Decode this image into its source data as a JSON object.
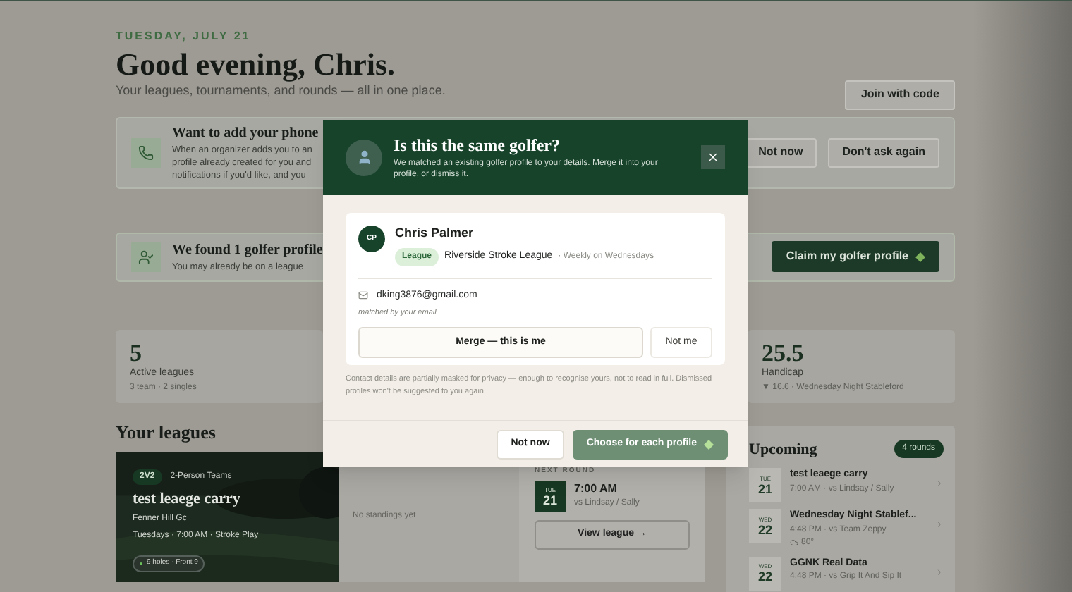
{
  "header": {
    "date": "TUESDAY, JULY 21",
    "title": "Good evening, Chris.",
    "subtitle": "Your leagues, tournaments, and rounds — all in one place.",
    "join_button": "Join with code"
  },
  "phone_banner": {
    "title": "Want to add your phone",
    "lines": [
      "When an organizer adds you to an",
      "profile already created for you and",
      "notifications if you'd like, and you"
    ],
    "buttons": [
      "Not now",
      "Don't ask again"
    ]
  },
  "profile_banner": {
    "title": "We found 1 golfer profile",
    "text": "You may already be on a league",
    "button": "Claim my golfer profile"
  },
  "stats": [
    {
      "value": "5",
      "label": "Active leagues",
      "detail": "3 team · 2 singles"
    },
    {
      "value": "25.5",
      "label": "Handicap",
      "detail": "▼ 16.6 · Wednesday Night Stableford"
    }
  ],
  "leagues": {
    "heading": "Your leagues",
    "card": {
      "format_badge": "2V2",
      "format": "2-Person Teams",
      "name": "test leaege carry",
      "course": "Fenner Hill Gc",
      "schedule": "Tuesdays · 7:00 AM · Stroke Play",
      "holes": "9 holes · Front 9",
      "standings": "No standings yet",
      "next_round": {
        "label": "NEXT ROUND",
        "day": "TUE",
        "date": "21",
        "time": "7:00 AM",
        "opponents": "vs Lindsay / Sally",
        "button": "View league →"
      }
    }
  },
  "upcoming": {
    "heading": "Upcoming",
    "count": "4 rounds",
    "items": [
      {
        "day": "TUE",
        "date": "21",
        "title": "test leaege carry",
        "detail": "7:00 AM · vs Lindsay / Sally"
      },
      {
        "day": "WED",
        "date": "22",
        "title": "Wednesday Night Stablef...",
        "detail": "4:48 PM · vs Team Zeppy",
        "weather": "80°"
      },
      {
        "day": "WED",
        "date": "22",
        "title": "GGNK Real Data",
        "detail": "4:48 PM · vs Grip It And Sip It"
      }
    ]
  },
  "modal": {
    "title": "Is this the same golfer?",
    "subtitle": "We matched an existing golfer profile to your details. Merge it into your profile, or dismiss it.",
    "profile": {
      "initials": "CP",
      "name": "Chris Palmer",
      "tag": "League",
      "league": "Riverside Stroke League",
      "schedule": "· Weekly on Wednesdays",
      "email": "dking3876@gmail.com",
      "match_note": "matched by your email",
      "merge_button": "Merge — this is me",
      "reject_button": "Not me"
    },
    "note": "Contact details are partially masked for privacy — enough to recognise yours, not to read in full. Dismissed profiles won't be suggested to you again.",
    "buttons": [
      {
        "label": "Not now",
        "kind": "secondary"
      },
      {
        "label": "Choose for each profile",
        "kind": "primary"
      }
    ]
  }
}
